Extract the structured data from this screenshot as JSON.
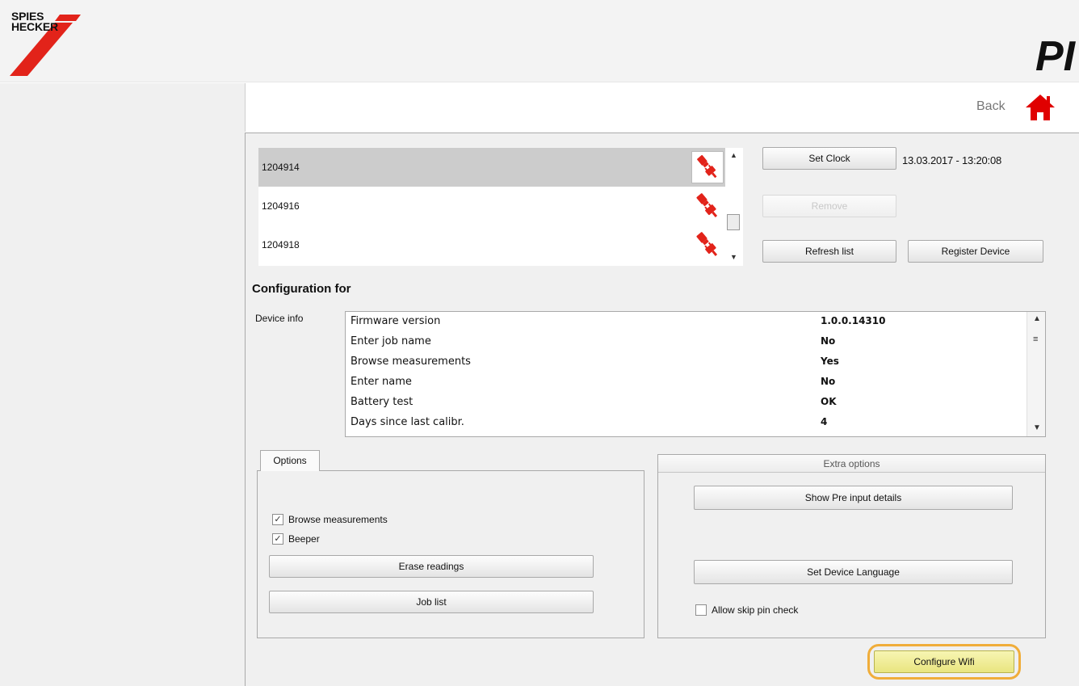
{
  "header": {
    "logo_line1": "SPIES",
    "logo_line2": "HECKER",
    "brand_letters": "PI",
    "colors": {
      "logo_red": "#e2231a",
      "header_bg": "#f3f3f3"
    }
  },
  "nav": {
    "back_label": "Back",
    "home_icon": "home-icon",
    "home_color": "#e00000"
  },
  "device_list": {
    "rows": [
      {
        "id": "1204914",
        "status_icon": "plug-disconnected-icon",
        "selected": true
      },
      {
        "id": "1204916",
        "status_icon": "plug-disconnected-icon",
        "selected": false
      },
      {
        "id": "1204918",
        "status_icon": "plug-disconnected-icon",
        "selected": false
      }
    ]
  },
  "device_actions": {
    "set_clock": "Set Clock",
    "clock_value": "13.03.2017 - 13:20:08",
    "remove": "Remove",
    "refresh": "Refresh list",
    "register": "Register Device"
  },
  "config": {
    "title": "Configuration for",
    "device_info_label": "Device info",
    "info_rows": [
      {
        "key": "Firmware version",
        "value": "1.0.0.14310"
      },
      {
        "key": "Enter job name",
        "value": "No"
      },
      {
        "key": "Browse measurements",
        "value": "Yes"
      },
      {
        "key": "Enter name",
        "value": "No"
      },
      {
        "key": "Battery test",
        "value": "OK"
      },
      {
        "key": "Days since last calibr.",
        "value": "4"
      }
    ]
  },
  "options": {
    "tab_label": "Options",
    "browse_label": "Browse measurements",
    "browse_checked": true,
    "beeper_label": "Beeper",
    "beeper_checked": true,
    "erase_label": "Erase readings",
    "joblist_label": "Job list"
  },
  "extra": {
    "header": "Extra options",
    "pre_input_label": "Show Pre input details",
    "language_label": "Set Device Language",
    "skip_pin_label": "Allow skip pin check",
    "skip_pin_checked": false
  },
  "wifi": {
    "label": "Configure Wifi",
    "highlight_color": "#f0ad3a"
  }
}
